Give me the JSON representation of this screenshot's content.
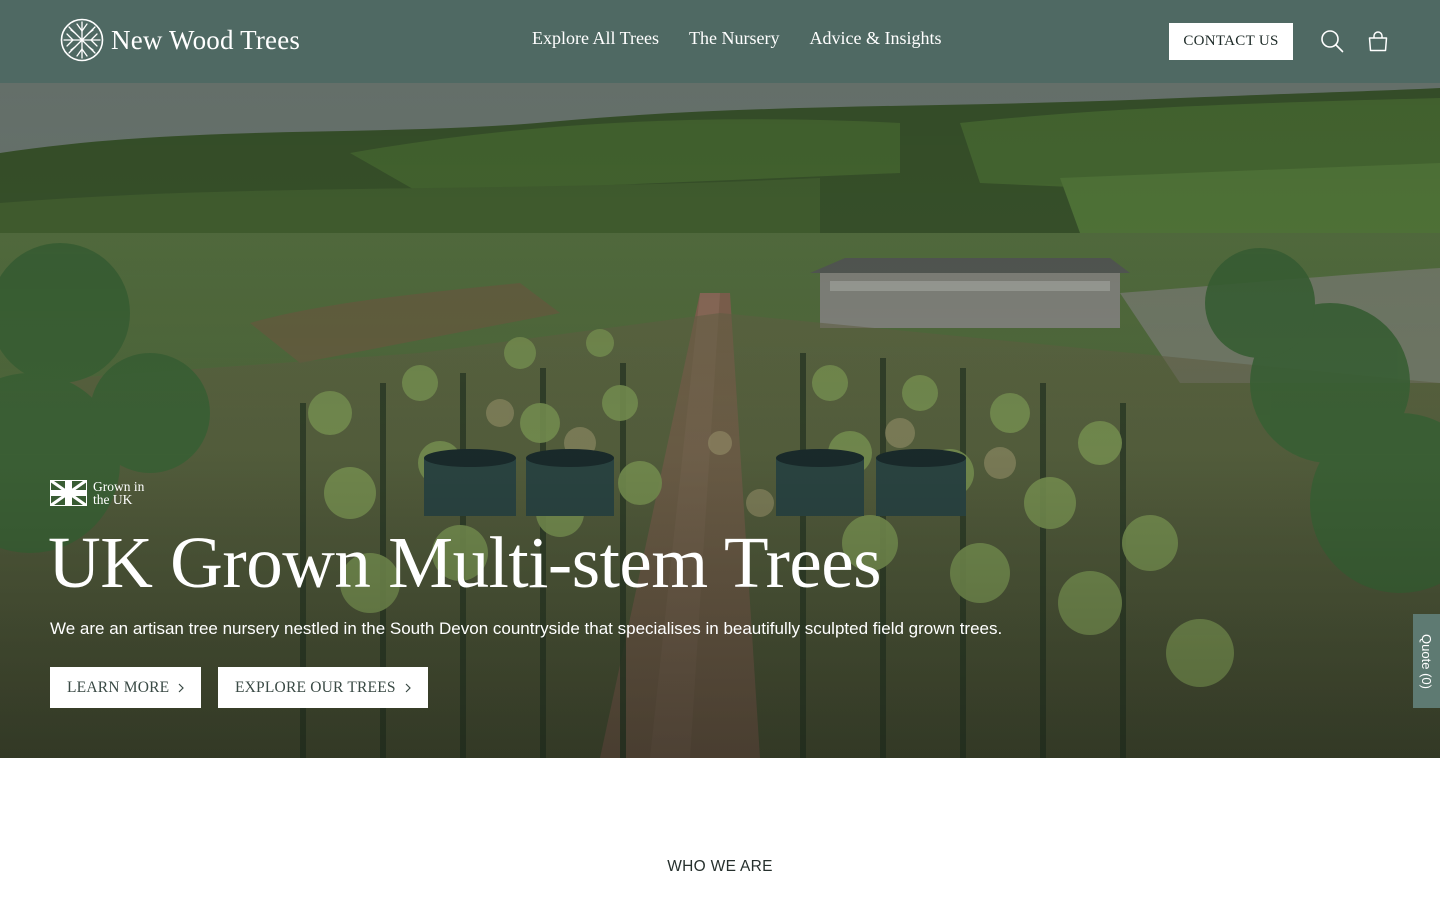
{
  "header": {
    "logo_text": "New Wood Trees",
    "logo_icon": "tree-roots-icon",
    "nav": [
      {
        "label": "Explore All Trees"
      },
      {
        "label": "The Nursery"
      },
      {
        "label": "Advice & Insights"
      }
    ],
    "contact_label": "CONTACT US",
    "search_icon": "search-icon",
    "cart_icon": "shopping-bag-icon"
  },
  "hero": {
    "badge_icon": "union-jack-icon",
    "badge_text": "Grown in the UK",
    "title": "UK Grown Multi-stem Trees",
    "subtitle": "We are an artisan tree nursery nestled in the South Devon countryside that specialises in beautifully sculpted field grown trees.",
    "buttons": [
      {
        "label": "LEARN MORE",
        "icon": "chevron-right-icon"
      },
      {
        "label": "EXPLORE OUR TREES",
        "icon": "chevron-right-icon"
      }
    ],
    "background": "aerial photo of tree nursery rows in green Devon hills"
  },
  "quote_tab": {
    "label": "Quote (0)"
  },
  "section": {
    "label": "WHO WE ARE"
  },
  "colors": {
    "header_bg": "#4f6963",
    "quote_tab_bg": "#5e7a72",
    "button_bg": "#ffffff",
    "text_light": "#ffffff",
    "text_dark": "#26302d"
  }
}
